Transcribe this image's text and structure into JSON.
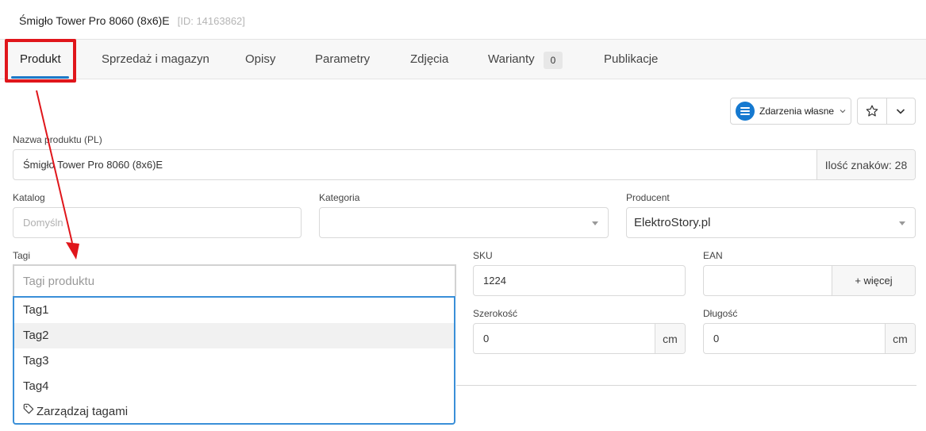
{
  "product": {
    "name": "Śmigło Tower Pro 8060 (8x6)E",
    "id_label": "[ID: 14163862]"
  },
  "tabs": [
    {
      "label": "Produkt",
      "active": true
    },
    {
      "label": "Sprzedaż i magazyn"
    },
    {
      "label": "Opisy"
    },
    {
      "label": "Parametry"
    },
    {
      "label": "Zdjęcia"
    },
    {
      "label": "Warianty",
      "badge": "0"
    },
    {
      "label": "Publikacje"
    }
  ],
  "toolbar": {
    "events_label": "Zdarzenia własne",
    "events_icon": "list-icon",
    "favorite_icon": "star-icon",
    "more_icon": "chevron-down-icon"
  },
  "form": {
    "name_label": "Nazwa produktu (PL)",
    "name_value": "Śmigło Tower Pro 8060 (8x6)E",
    "char_count": "Ilość znaków: 28",
    "catalog_label": "Katalog",
    "catalog_value": "Domyśln",
    "category_label": "Kategoria",
    "category_value": "",
    "producer_label": "Producent",
    "producer_value": "ElektroStory.pl",
    "tags_label": "Tagi",
    "tags_placeholder": "Tagi produktu",
    "sku_label": "SKU",
    "sku_value": "1224",
    "ean_label": "EAN",
    "ean_value": "",
    "ean_more": "+ więcej",
    "width_label": "Szerokość",
    "width_value": "0",
    "width_unit": "cm",
    "length_label": "Długość",
    "length_value": "0",
    "length_unit": "cm"
  },
  "tag_dropdown": {
    "options": [
      "Tag1",
      "Tag2",
      "Tag3",
      "Tag4"
    ],
    "hovered": "Tag2",
    "manage_label": "Zarządzaj tagami",
    "manage_icon": "tag-icon"
  },
  "colors": {
    "accent": "#1e7ac9",
    "annotation": "#e0161b",
    "dropdown_border": "#3a8fd8"
  }
}
